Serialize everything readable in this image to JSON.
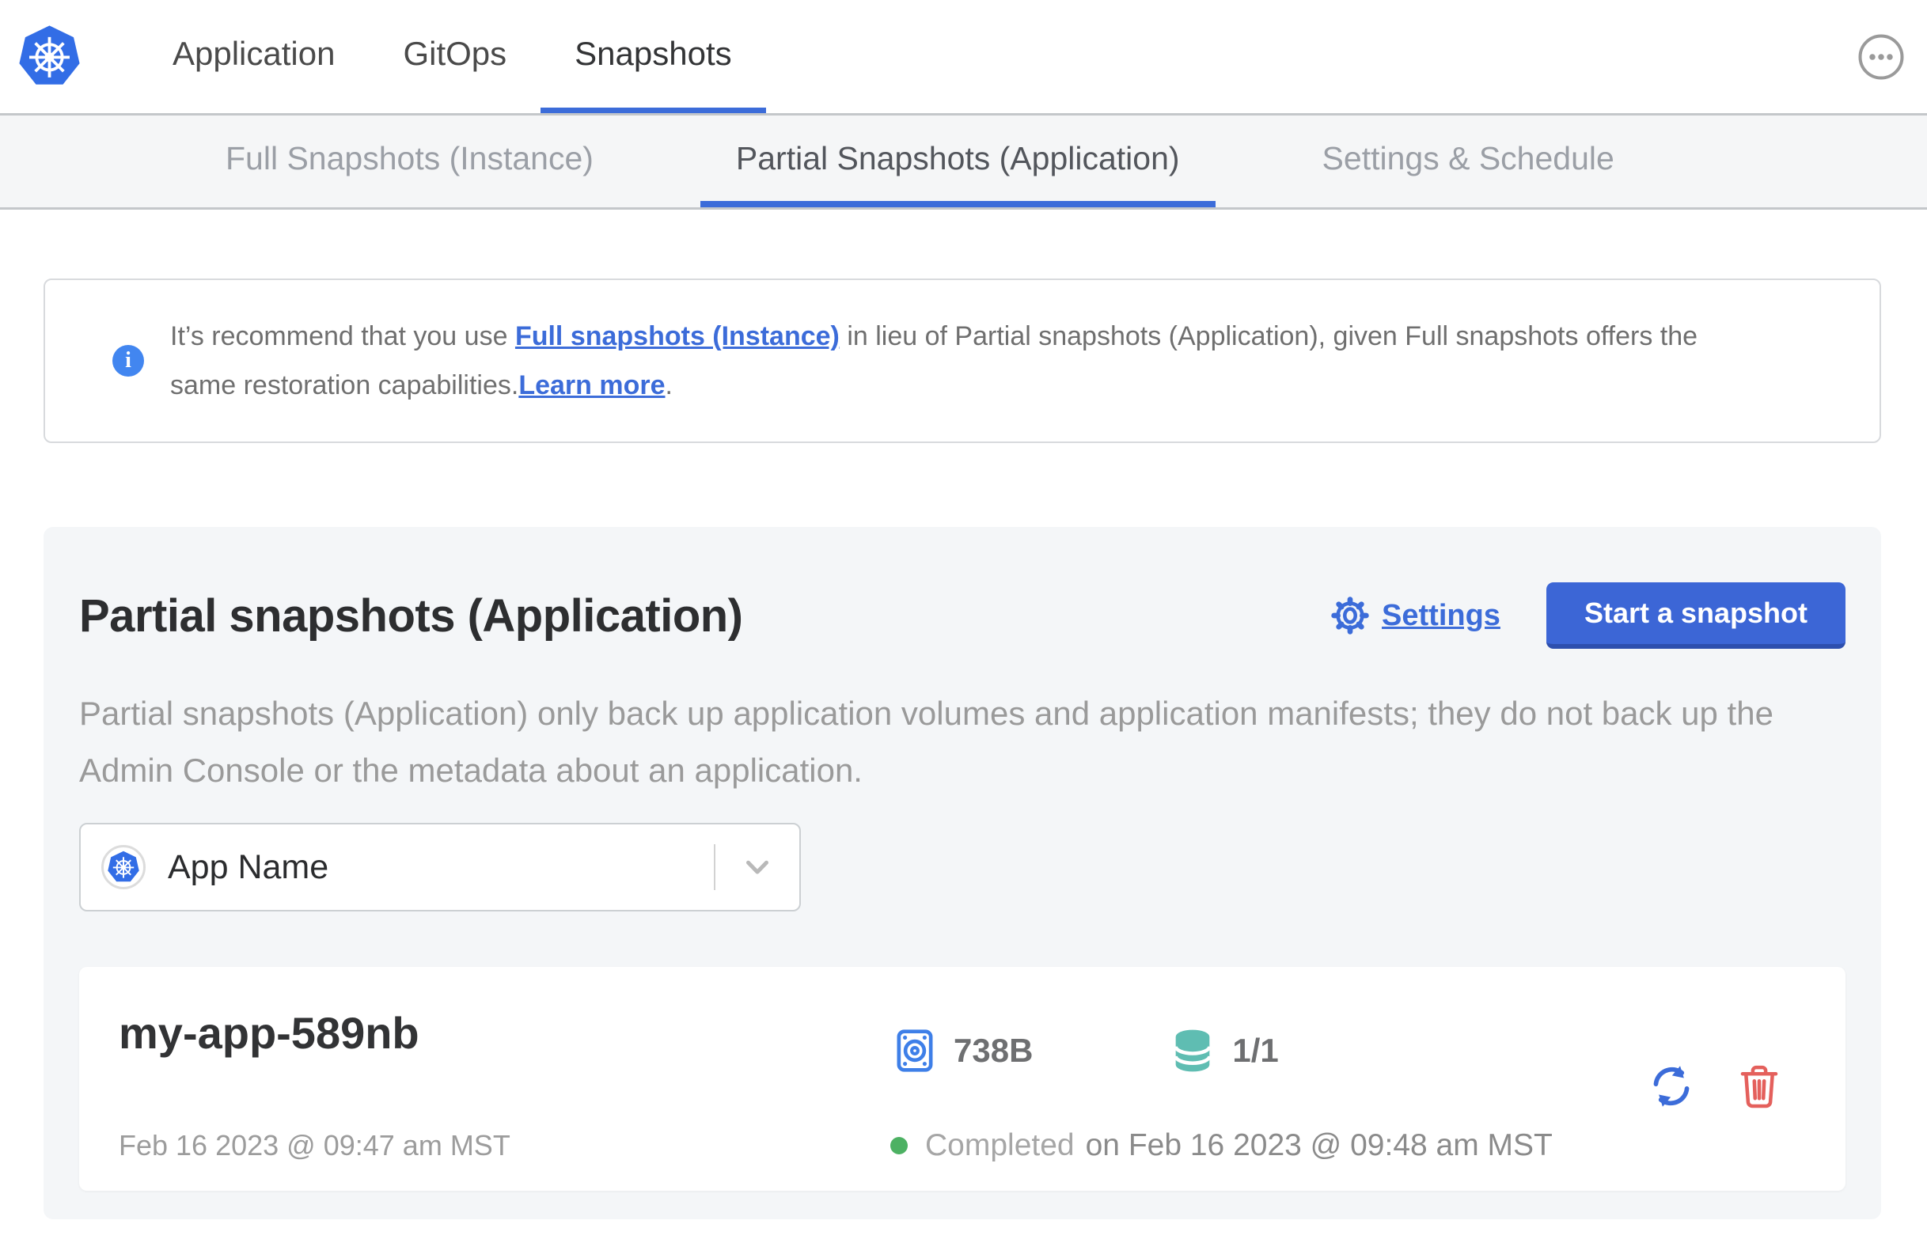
{
  "header": {
    "brand_icon": "kubernetes-logo",
    "nav_items": [
      {
        "label": "Application",
        "active": false
      },
      {
        "label": "GitOps",
        "active": false
      },
      {
        "label": "Snapshots",
        "active": true
      }
    ],
    "overflow_menu_icon": "ellipsis-icon"
  },
  "subnav": {
    "tabs": [
      {
        "label": "Full Snapshots (Instance)",
        "active": false
      },
      {
        "label": "Partial Snapshots (Application)",
        "active": true
      },
      {
        "label": "Settings & Schedule",
        "active": false
      }
    ]
  },
  "banner": {
    "icon": "info-icon",
    "text_start": "It’s recommend that you use ",
    "link_full_snapshots": "Full snapshots (Instance)",
    "text_middle": " in lieu of Partial snapshots (Application), given Full snapshots offers the same restoration capabilities.",
    "link_learn_more": "Learn more",
    "text_end": "."
  },
  "panel": {
    "title": "Partial snapshots (Application)",
    "settings_label": "Settings",
    "start_button_label": "Start a snapshot",
    "description": "Partial snapshots (Application) only back up application volumes and application manifests; they do not back up the Admin Console or the metadata about an application.",
    "app_selector": {
      "icon": "kubernetes-icon",
      "selected_value": "App Name"
    },
    "snapshots": [
      {
        "name": "my-app-589nb",
        "started_at": "Feb 16 2023 @ 09:47 am MST",
        "size": "738B",
        "volumes": "1/1",
        "status": "Completed",
        "completed_at": "on Feb 16 2023 @ 09:48 am MST"
      }
    ]
  },
  "colors": {
    "primary_blue": "#3c6cd9",
    "kubernetes_blue": "#326de6",
    "info_blue": "#4286f0",
    "volume_teal": "#5fbdb2",
    "success_green": "#4db163",
    "danger_red": "#e4605c"
  }
}
